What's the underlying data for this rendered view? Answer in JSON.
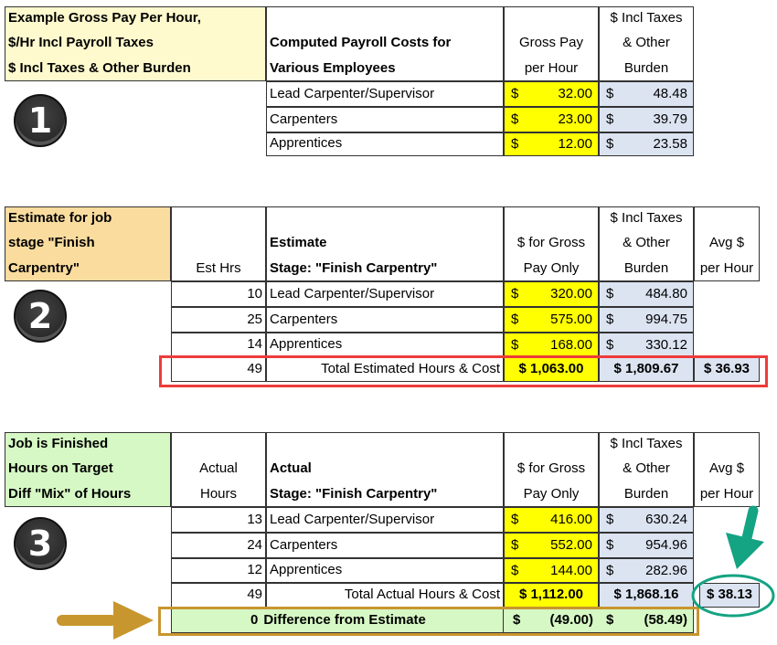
{
  "section1": {
    "badge": "1",
    "label_lines": [
      "Example Gross Pay Per Hour,",
      "$/Hr Incl Payroll Taxes",
      "$ Incl Taxes & Other Burden"
    ],
    "header_desc": [
      "Computed Payroll Costs for",
      "Various Employees"
    ],
    "header_gross": [
      "Gross Pay",
      "per Hour"
    ],
    "header_burden": [
      "$ Incl Taxes",
      "& Other",
      "Burden"
    ],
    "rows": [
      {
        "name": "Lead Carpenter/Supervisor",
        "gross": "32.00",
        "burden": "48.48"
      },
      {
        "name": "Carpenters",
        "gross": "23.00",
        "burden": "39.79"
      },
      {
        "name": "Apprentices",
        "gross": "12.00",
        "burden": "23.58"
      }
    ]
  },
  "section2": {
    "badge": "2",
    "label_lines": [
      "Estimate for job",
      "stage \"Finish",
      "Carpentry\""
    ],
    "header_hrs": [
      "Est Hrs"
    ],
    "header_desc": [
      "Estimate",
      "Stage: \"Finish Carpentry\""
    ],
    "header_gross": [
      "$ for Gross",
      "Pay Only"
    ],
    "header_burden": [
      "$ Incl Taxes",
      "& Other",
      "Burden"
    ],
    "header_avg": [
      "Avg $",
      "per Hour"
    ],
    "rows": [
      {
        "hrs": "10",
        "name": "Lead Carpenter/Supervisor",
        "gross": "320.00",
        "burden": "484.80"
      },
      {
        "hrs": "25",
        "name": "Carpenters",
        "gross": "575.00",
        "burden": "994.75"
      },
      {
        "hrs": "14",
        "name": "Apprentices",
        "gross": "168.00",
        "burden": "330.12"
      }
    ],
    "total": {
      "hrs": "49",
      "label": "Total Estimated Hours & Cost",
      "gross": "$ 1,063.00",
      "burden": "$ 1,809.67",
      "avg": "$ 36.93"
    }
  },
  "section3": {
    "badge": "3",
    "label_lines": [
      "Job is Finished",
      "Hours on Target",
      "Diff \"Mix\" of Hours"
    ],
    "header_hrs": [
      "Actual",
      "Hours"
    ],
    "header_desc": [
      "Actual",
      "Stage: \"Finish Carpentry\""
    ],
    "header_gross": [
      "$ for Gross",
      "Pay Only"
    ],
    "header_burden": [
      "$ Incl Taxes",
      "& Other",
      "Burden"
    ],
    "header_avg": [
      "Avg $",
      "per Hour"
    ],
    "rows": [
      {
        "hrs": "13",
        "name": "Lead Carpenter/Supervisor",
        "gross": "416.00",
        "burden": "630.24"
      },
      {
        "hrs": "24",
        "name": "Carpenters",
        "gross": "552.00",
        "burden": "954.96"
      },
      {
        "hrs": "12",
        "name": "Apprentices",
        "gross": "144.00",
        "burden": "282.96"
      }
    ],
    "total": {
      "hrs": "49",
      "label": "Total Actual Hours & Cost",
      "gross": "$ 1,112.00",
      "burden": "$ 1,868.16",
      "avg": "$ 38.13"
    },
    "difference": {
      "hrs": "0",
      "label": "Difference from Estimate",
      "gross": "(49.00)",
      "burden": "(58.49)"
    }
  },
  "currency_symbol": "$",
  "colors": {
    "gross_fill": "#ffff00",
    "burden_fill": "#dce4f2",
    "estimate_highlight": "#ee3b3b",
    "difference_highlight": "#c8962e",
    "avg_highlight": "#14a383"
  }
}
